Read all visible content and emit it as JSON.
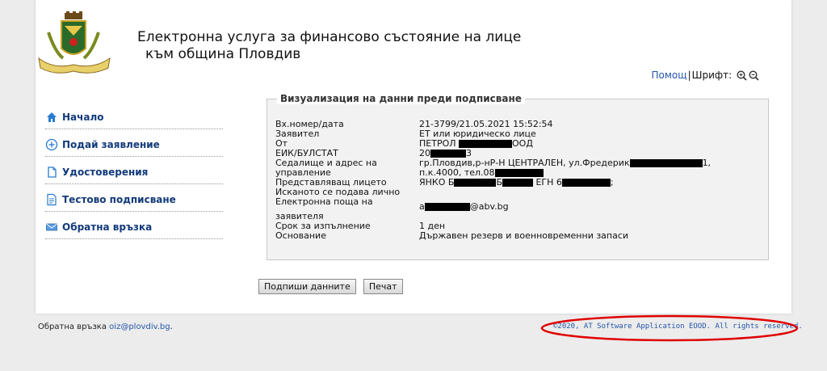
{
  "header": {
    "title_line1": "Електронна услуга за финансово състояние на лице",
    "title_line2": "към община Пловдив",
    "help_link": "Помощ",
    "separator": "|",
    "font_label": "Шрифт:",
    "zoom_icons": [
      "zoom-in-icon",
      "zoom-out-icon"
    ],
    "logo_icon": "plovdiv-coat-of-arms-icon"
  },
  "nav": {
    "items": [
      {
        "label": "Начало",
        "icon": "home-icon"
      },
      {
        "label": "Подай заявление",
        "icon": "plus-circle-icon"
      },
      {
        "label": "Удостоверения",
        "icon": "document-icon"
      },
      {
        "label": "Тестово подписване",
        "icon": "sign-document-icon"
      },
      {
        "label": "Обратна връзка",
        "icon": "mail-icon"
      }
    ]
  },
  "preview": {
    "legend": "Визуализация на данни преди подписване",
    "rows": [
      {
        "k": "Вх.номер/дата",
        "v": "21-3799/21.05.2021 15:52:54"
      },
      {
        "k": "Заявител",
        "v": "ЕТ или юридическо лице"
      },
      {
        "k": "От",
        "v1": "ПЕТРОЛ ",
        "v2": "ООД"
      },
      {
        "k": "ЕИК/БУЛСТАТ",
        "v1": "20",
        "v2": "3"
      },
      {
        "k": "Седалище и адрес на",
        "v1": "гр.Пловдив,р-нР-Н ЦЕНТРАЛЕН, ул.Фредерик",
        "v2": "1,"
      },
      {
        "k": "управление",
        "v1": "п.к.4000, тел.08",
        "v2": ""
      },
      {
        "k": "Представляващ лицето",
        "v1": "ЯНКО Б",
        "v2": "Б",
        "v3": " ЕГН 6",
        "v4": ";"
      },
      {
        "k": "Исканото се подава лично",
        "v": ""
      },
      {
        "k": "Електронна поща на",
        "v1": "a",
        "v2": "@abv.bg"
      },
      {
        "k": "заявителя",
        "v": ""
      },
      {
        "k": "Срок за изпълнение",
        "v": "1 ден"
      },
      {
        "k": "Основание",
        "v": "Държавен резерв и военновременни запаси"
      }
    ]
  },
  "buttons": {
    "sign": "Подпиши данните",
    "print": "Печат"
  },
  "footer": {
    "feedback_label": "Обратна връзка",
    "feedback_email": "oiz@plovdiv.bg",
    "feedback_end": ".",
    "copyright": "©2020, AT Software Application EOOD. All rights reserved."
  },
  "colors": {
    "nav_text": "#123a7a",
    "link": "#2255aa",
    "highlight_oval": "#e00000"
  }
}
